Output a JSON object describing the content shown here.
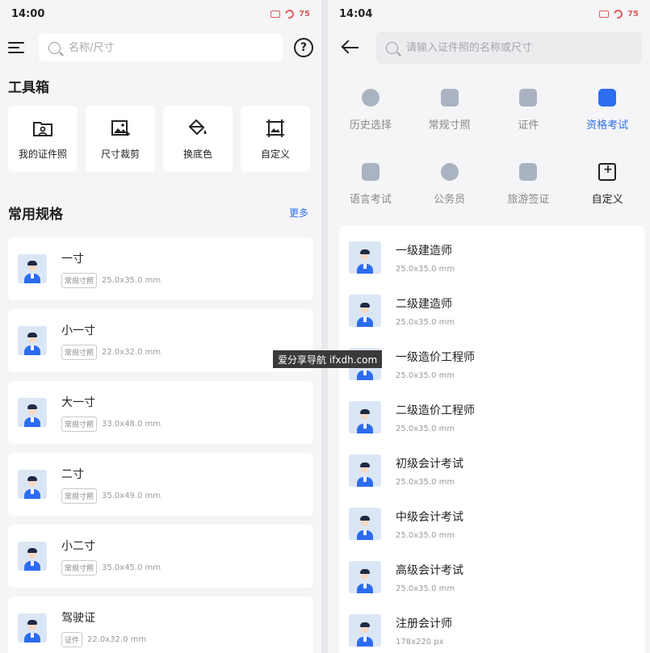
{
  "left": {
    "status_time": "14:00",
    "battery": "75",
    "search_placeholder": "名称/尺寸",
    "help_symbol": "?",
    "toolbox_title": "工具箱",
    "tools": [
      {
        "label": "我的证件照",
        "icon": "folder-person-icon"
      },
      {
        "label": "尺寸裁剪",
        "icon": "image-crop-icon"
      },
      {
        "label": "换底色",
        "icon": "paint-bucket-icon"
      },
      {
        "label": "自定义",
        "icon": "custom-frame-icon"
      }
    ],
    "specs_title": "常用规格",
    "more_label": "更多",
    "specs": [
      {
        "name": "一寸",
        "tag": "常规寸照",
        "size": "25.0x35.0 mm"
      },
      {
        "name": "小一寸",
        "tag": "常规寸照",
        "size": "22.0x32.0 mm"
      },
      {
        "name": "大一寸",
        "tag": "常规寸照",
        "size": "33.0x48.0 mm"
      },
      {
        "name": "二寸",
        "tag": "常规寸照",
        "size": "35.0x49.0 mm"
      },
      {
        "name": "小二寸",
        "tag": "常规寸照",
        "size": "35.0x45.0 mm"
      },
      {
        "name": "驾驶证",
        "tag": "证件",
        "size": "22.0x32.0 mm"
      }
    ]
  },
  "right": {
    "status_time": "14:04",
    "battery": "75",
    "search_placeholder": "请输入证件照的名称或尺寸",
    "categories": [
      {
        "label": "历史选择",
        "icon": "history-icon",
        "state": "normal"
      },
      {
        "label": "常规寸照",
        "icon": "person-icon",
        "state": "normal"
      },
      {
        "label": "证件",
        "icon": "id-card-icon",
        "state": "normal"
      },
      {
        "label": "资格考试",
        "icon": "briefcase-icon",
        "state": "active"
      },
      {
        "label": "语言考试",
        "icon": "language-icon",
        "state": "normal"
      },
      {
        "label": "公务员",
        "icon": "badge-icon",
        "state": "normal"
      },
      {
        "label": "旅游签证",
        "icon": "passport-icon",
        "state": "normal"
      },
      {
        "label": "自定义",
        "icon": "custom-frame-icon",
        "state": "dark"
      }
    ],
    "items": [
      {
        "name": "一级建造师",
        "size": "25.0x35.0 mm"
      },
      {
        "name": "二级建造师",
        "size": "25.0x35.0 mm"
      },
      {
        "name": "一级造价工程师",
        "size": "25.0x35.0 mm"
      },
      {
        "name": "二级造价工程师",
        "size": "25.0x35.0 mm"
      },
      {
        "name": "初级会计考试",
        "size": "25.0x35.0 mm"
      },
      {
        "name": "中级会计考试",
        "size": "25.0x35.0 mm"
      },
      {
        "name": "高级会计考试",
        "size": "25.0x35.0 mm"
      },
      {
        "name": "注册会计师",
        "size": "178x220 px"
      }
    ]
  },
  "watermark": "爱分享导航 ifxdh.com",
  "colors": {
    "accent": "#2c6df2",
    "background": "#f5f5f7",
    "card": "#ffffff"
  }
}
